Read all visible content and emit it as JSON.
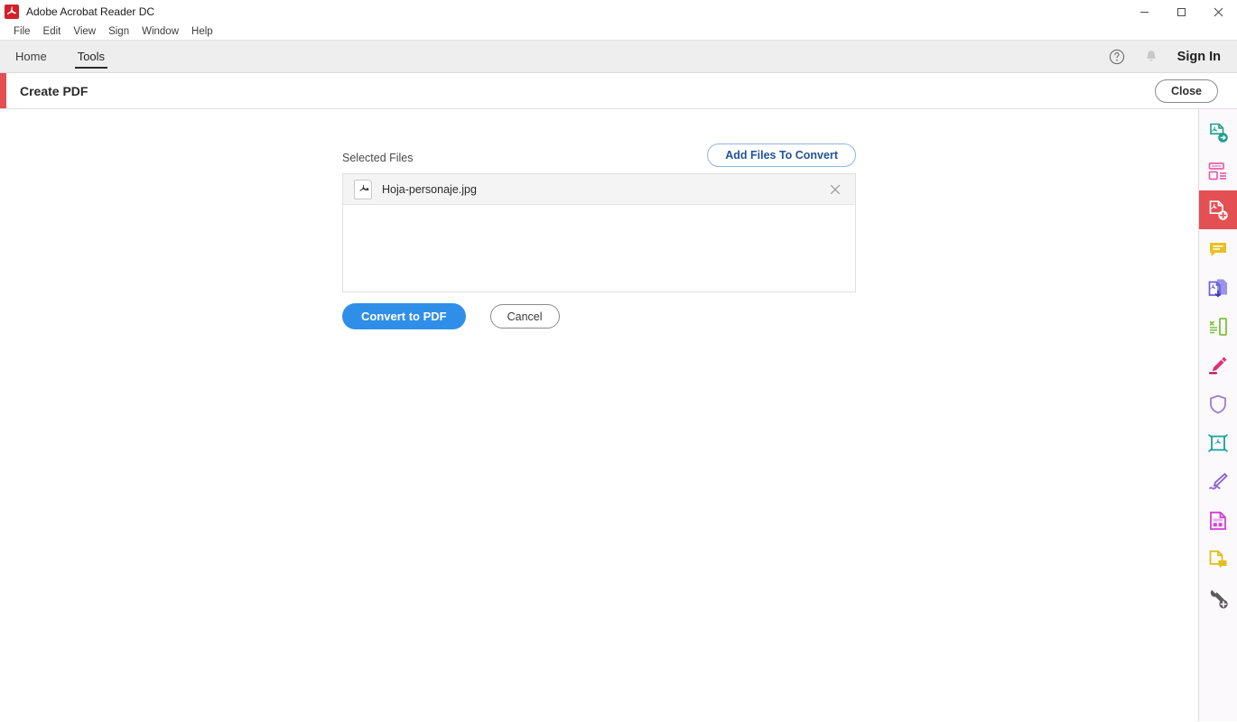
{
  "window": {
    "app_title": "Adobe Acrobat Reader DC",
    "logo_icon": "acrobat-logo-icon",
    "controls": [
      {
        "name": "minimize",
        "icon": "minimize-icon"
      },
      {
        "name": "maximize",
        "icon": "maximize-icon"
      },
      {
        "name": "close",
        "icon": "close-icon"
      }
    ]
  },
  "menubar": {
    "items": [
      {
        "label": "File"
      },
      {
        "label": "Edit"
      },
      {
        "label": "View"
      },
      {
        "label": "Sign"
      },
      {
        "label": "Window"
      },
      {
        "label": "Help"
      }
    ]
  },
  "tabbar": {
    "tabs": [
      {
        "label": "Home",
        "active": false
      },
      {
        "label": "Tools",
        "active": true
      }
    ],
    "help_icon": "help-circle-icon",
    "bell_icon": "bell-icon",
    "signin_label": "Sign In"
  },
  "tool_header": {
    "title": "Create PDF",
    "close_label": "Close",
    "accent_color": "#e34f52"
  },
  "main": {
    "selected_files_label": "Selected Files",
    "add_files_label": "Add Files To Convert",
    "files": [
      {
        "name": "Hoja-personaje.jpg",
        "icon": "image-file-icon",
        "remove_icon": "close-icon"
      }
    ],
    "convert_label": "Convert to PDF",
    "cancel_label": "Cancel",
    "convert_color": "#2f8fe8",
    "add_files_color": "#22559a"
  },
  "sidebar": {
    "items": [
      {
        "name": "export-pdf-icon",
        "label": "Export PDF",
        "color": "#1f9e8f",
        "active": false
      },
      {
        "name": "organize-pages-icon",
        "label": "Organize Pages",
        "color": "#e462a8",
        "active": false
      },
      {
        "name": "create-pdf-icon",
        "label": "Create PDF",
        "color": "#ffffff",
        "active": true
      },
      {
        "name": "comment-icon",
        "label": "Comment",
        "color": "#e8c020",
        "active": false
      },
      {
        "name": "combine-files-icon",
        "label": "Combine Files",
        "color": "#6a63d6",
        "active": false
      },
      {
        "name": "compress-pdf-icon",
        "label": "Compress PDF",
        "color": "#7ec13a",
        "active": false
      },
      {
        "name": "edit-pdf-icon",
        "label": "Edit PDF",
        "color": "#dd2f78",
        "active": false
      },
      {
        "name": "protect-icon",
        "label": "Protect",
        "color": "#9b7ed6",
        "active": false
      },
      {
        "name": "redact-icon",
        "label": "Redact",
        "color": "#18a0a0",
        "active": false
      },
      {
        "name": "fill-and-sign-icon",
        "label": "Fill & Sign",
        "color": "#8a5fd6",
        "active": false
      },
      {
        "name": "prepare-form-icon",
        "label": "Prepare Form",
        "color": "#d43fd4",
        "active": false
      },
      {
        "name": "send-comments-icon",
        "label": "Send for Comments",
        "color": "#e0c020",
        "active": false
      },
      {
        "name": "more-tools-icon",
        "label": "More Tools",
        "color": "#5c5c5c",
        "active": false
      }
    ]
  }
}
